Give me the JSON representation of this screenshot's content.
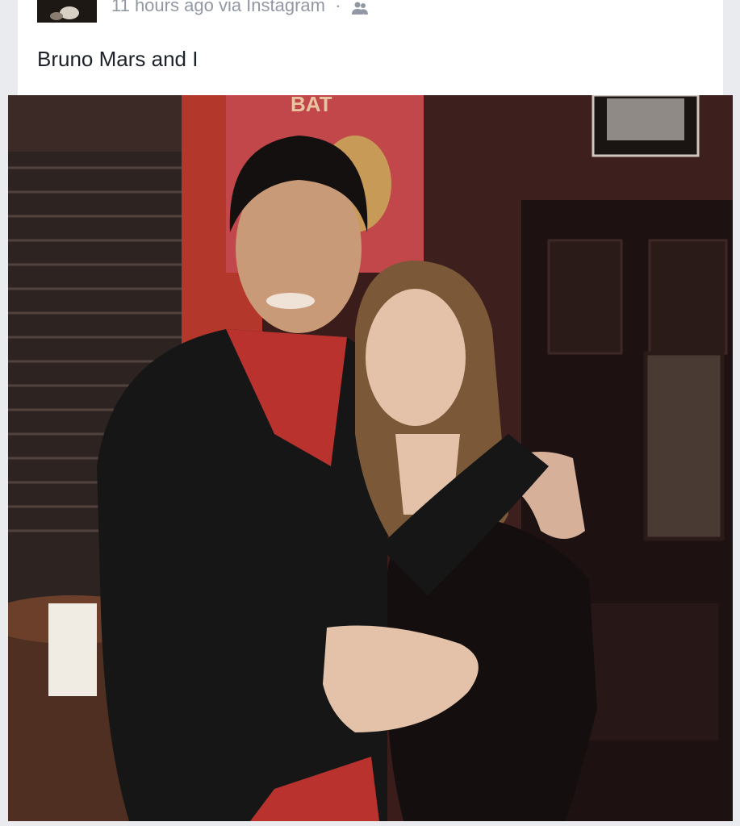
{
  "post": {
    "timestamp": "11 hours ago",
    "via": "via Instagram",
    "separator": "·",
    "audience_icon": "friends-icon",
    "caption": "Bruno Mars and I"
  },
  "photo": {
    "icon": "photo-image"
  },
  "colors": {
    "meta_text": "#9197a3",
    "caption_text": "#1d2129",
    "background": "#e9ebee"
  }
}
